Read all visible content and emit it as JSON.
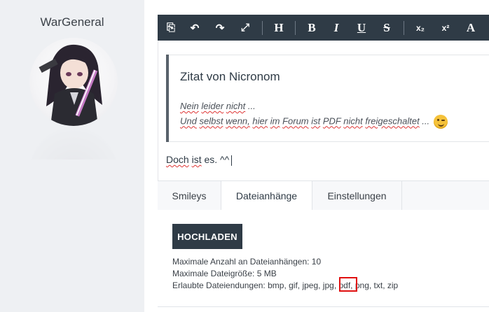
{
  "sidebar": {
    "username": "WarGeneral"
  },
  "toolbar": {
    "buttons": [
      {
        "name": "source-code-icon",
        "glyph": "⎘"
      },
      {
        "name": "undo-icon",
        "glyph": "↶"
      },
      {
        "name": "redo-icon",
        "glyph": "↷"
      },
      {
        "name": "fullscreen-icon",
        "glyph": "⤢"
      },
      {
        "name": "heading-icon",
        "glyph": "H"
      },
      {
        "name": "bold-icon",
        "glyph": "B"
      },
      {
        "name": "italic-icon",
        "glyph": "I"
      },
      {
        "name": "underline-icon",
        "glyph": "U"
      },
      {
        "name": "strikethrough-icon",
        "glyph": "S"
      },
      {
        "name": "subscript-icon",
        "glyph": "x₂"
      },
      {
        "name": "superscript-icon",
        "glyph": "x²"
      },
      {
        "name": "font-color-icon",
        "glyph": "A"
      }
    ]
  },
  "quote": {
    "title": "Zitat von Nicronom",
    "line1": {
      "w1": "Nein",
      "w2": "leider",
      "w3": "nicht",
      "rest": " ..."
    },
    "line2": {
      "w1": "Und",
      "w2": "selbst",
      "w3": "wenn,",
      "w4": "hier",
      "w5": "im",
      "w6": "Forum",
      "w7": "ist",
      "w8": "PDF",
      "w9": "nicht",
      "w10": "freigeschaltet",
      "rest": " ..."
    },
    "emoji": "wink-emoji"
  },
  "reply": {
    "w1": "Doch",
    "w2": "ist",
    "rest": " es. ^^"
  },
  "tabs": [
    {
      "label": "Smileys"
    },
    {
      "label": "Dateianhänge"
    },
    {
      "label": "Einstellungen"
    }
  ],
  "upload": {
    "button_label": "HOCHLADEN",
    "max_count": "Maximale Anzahl an Dateianhängen: 10",
    "max_size": "Maximale Dateigröße: 5 MB",
    "allowed": "Erlaubte Dateiendungen: bmp, gif, jpeg, jpg, pdf, png, txt, zip"
  },
  "colors": {
    "toolbar_bg": "#2f3b46",
    "highlight": "#e01010"
  }
}
